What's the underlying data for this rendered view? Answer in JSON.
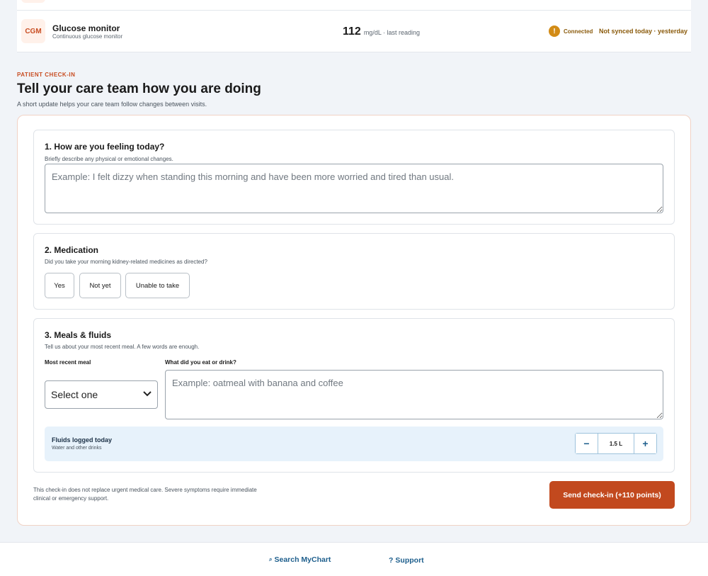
{
  "device": {
    "badge": "CGM",
    "name": "Glucose monitor",
    "subtitle": "Continuous glucose monitor",
    "reading_value": "112",
    "reading_unit": "mg/dL · last reading",
    "status_icon": "!",
    "status_label": "Connected",
    "sync_status": "Not synced today · yesterday"
  },
  "header": {
    "eyebrow": "PATIENT CHECK-IN",
    "title": "Tell your care team how you are doing",
    "subtitle": "A short update helps your care team follow changes between visits."
  },
  "feeling": {
    "title": "1. How are you feeling today?",
    "help": "Briefly describe any physical or emotional changes.",
    "placeholder": "Example: I felt dizzy when standing this morning and have been more worried and tired than usual."
  },
  "medication": {
    "title": "2. Medication",
    "question": "Did you take your morning kidney-related medicines as directed?",
    "options": [
      "Yes",
      "Not yet",
      "Unable to take"
    ]
  },
  "meals": {
    "title": "3. Meals & fluids",
    "help": "Tell us about your most recent meal. A few words are enough.",
    "meal_label": "Most recent meal",
    "meal_value": "Select one",
    "eat_label": "What did you eat or drink?",
    "eat_placeholder": "Example: oatmeal with banana and coffee",
    "fluids_title": "Fluids logged today",
    "fluids_sub": "Water and other drinks",
    "fluids_value": "1.5 L",
    "decrement": "−",
    "increment": "+"
  },
  "submit": {
    "disclaimer": "This check-in does not replace urgent medical care. Severe symptoms require immediate clinical or emergency support.",
    "button": "Send check-in (+110 points)"
  },
  "footer": {
    "search_icon": "⌕",
    "search_label": "Search MyChart",
    "support_icon": "?",
    "support_label": "Support"
  }
}
